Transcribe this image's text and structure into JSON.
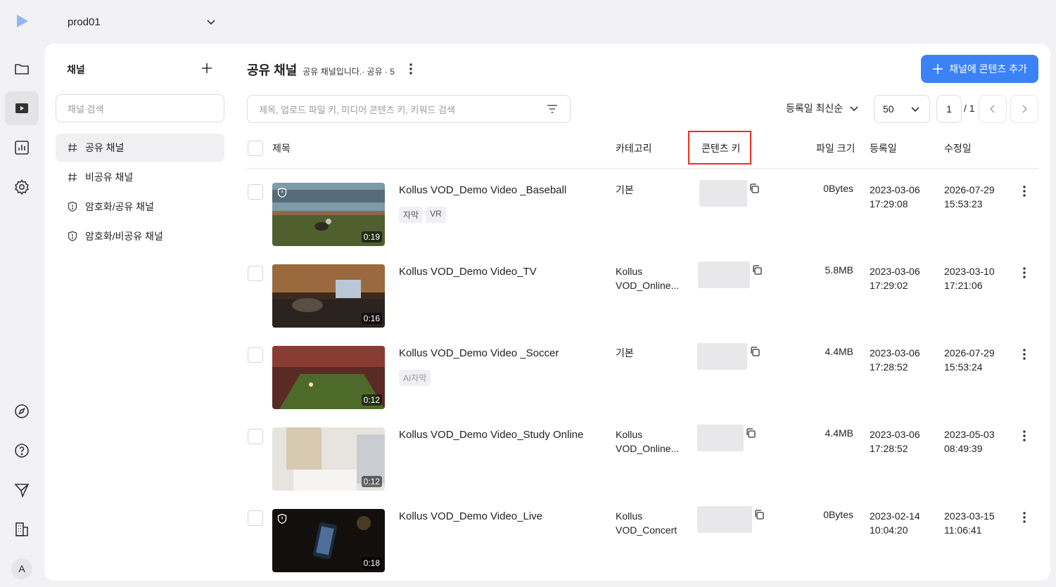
{
  "workspace": {
    "name": "prod01"
  },
  "sidebar": {
    "title": "채널",
    "search_placeholder": "채널 검색",
    "items": [
      {
        "label": "공유 채널",
        "icon": "hash-icon"
      },
      {
        "label": "비공유 채널",
        "icon": "hash-icon"
      },
      {
        "label": "암호화/공유 채널",
        "icon": "shield-icon"
      },
      {
        "label": "암호화/비공유 채널",
        "icon": "shield-icon"
      }
    ]
  },
  "header": {
    "title": "공유 채널",
    "description": "공유 채널입니다.· 공유 · 5",
    "add_button": "채널에 콘텐츠 추가"
  },
  "toolbar": {
    "search_placeholder": "제목, 업로드 파일 키, 미디어 콘텐츠 키, 키워드 검색",
    "sort_label": "등록일 최신순",
    "per_page": "50",
    "page": "1",
    "page_total": "/ 1"
  },
  "table": {
    "columns": {
      "title": "제목",
      "category": "카테고리",
      "content_key": "콘텐츠 키",
      "file_size": "파일 크기",
      "created": "등록일",
      "modified": "수정일"
    },
    "rows": [
      {
        "title": "Kollus VOD_Demo Video _Baseball",
        "duration": "0:19",
        "tags": [
          "자막",
          "VR"
        ],
        "category_1": "기본",
        "category_2": "",
        "size": "0Bytes",
        "created_date": "2023-03-06",
        "created_time": "17:29:08",
        "modified_date": "2026-07-29",
        "modified_time": "15:53:23"
      },
      {
        "title": "Kollus VOD_Demo Video_TV",
        "duration": "0:16",
        "tags": [],
        "category_1": "Kollus",
        "category_2": "VOD_Online...",
        "size": "5.8MB",
        "created_date": "2023-03-06",
        "created_time": "17:29:02",
        "modified_date": "2023-03-10",
        "modified_time": "17:21:06"
      },
      {
        "title": "Kollus VOD_Demo Video _Soccer",
        "duration": "0:12",
        "tags": [
          "AI자막"
        ],
        "category_1": "기본",
        "category_2": "",
        "size": "4.4MB",
        "created_date": "2023-03-06",
        "created_time": "17:28:52",
        "modified_date": "2026-07-29",
        "modified_time": "15:53:24"
      },
      {
        "title": "Kollus VOD_Demo Video_Study Online",
        "duration": "0:12",
        "tags": [],
        "category_1": "Kollus",
        "category_2": "VOD_Online...",
        "size": "4.4MB",
        "created_date": "2023-03-06",
        "created_time": "17:28:52",
        "modified_date": "2023-05-03",
        "modified_time": "08:49:39"
      },
      {
        "title": "Kollus VOD_Demo Video_Live",
        "duration": "0:18",
        "tags": [],
        "category_1": "Kollus",
        "category_2": "VOD_Concert",
        "size": "0Bytes",
        "created_date": "2023-02-14",
        "created_time": "10:04:20",
        "modified_date": "2023-03-15",
        "modified_time": "11:06:41"
      }
    ]
  },
  "user": {
    "avatar_letter": "A"
  },
  "colors": {
    "accent": "#3b82f6",
    "highlight": "#e5311c"
  }
}
